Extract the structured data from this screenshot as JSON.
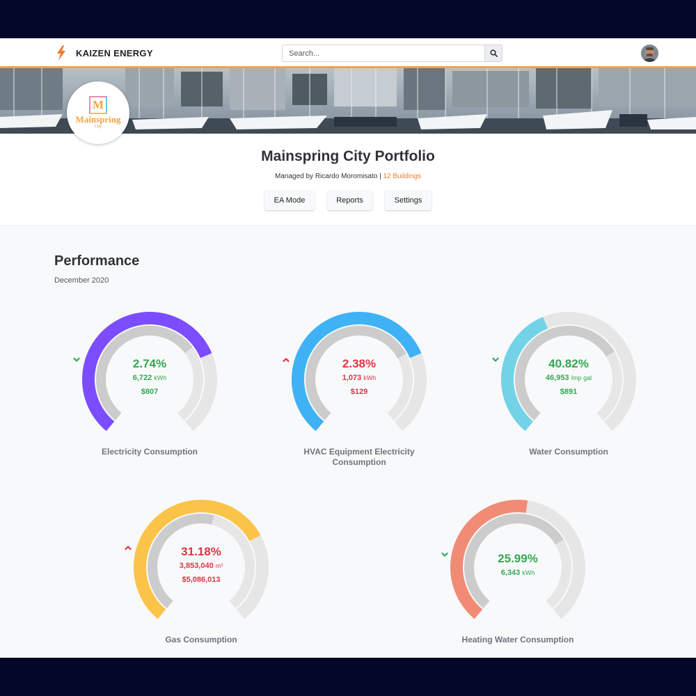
{
  "brand": {
    "name": "KAIZEN ENERGY",
    "icon": "lightning-bolt-icon",
    "color": "#f07a30"
  },
  "search": {
    "placeholder": "Search...",
    "icon": "search-icon"
  },
  "user": {
    "avatar": "user-avatar"
  },
  "portfolio": {
    "logo_text": "M",
    "logo_name": "Mainspring",
    "logo_sub": "City",
    "title": "Mainspring City Portfolio",
    "managed_by": "Managed by Ricardo Moromisato",
    "separator": "|",
    "buildings": "12 Buildings"
  },
  "actions": {
    "ea_mode": "EA Mode",
    "reports": "Reports",
    "settings": "Settings"
  },
  "performance": {
    "title": "Performance",
    "date": "December 2020"
  },
  "gauges": [
    {
      "label": "Electricity Consumption",
      "direction": "down",
      "percent": "2.74%",
      "usage": "6,722",
      "unit": "kWh",
      "cost": "$807",
      "color": "#7c4dff",
      "fill_fraction": 0.74,
      "inner_fraction": 0.69,
      "status": "green"
    },
    {
      "label": "HVAC Equipment Electricity Consumption",
      "direction": "up",
      "percent": "2.38%",
      "usage": "1,073",
      "unit": "kWh",
      "cost": "$129",
      "color": "#3eb2f5",
      "fill_fraction": 0.74,
      "inner_fraction": 0.72,
      "status": "red"
    },
    {
      "label": "Water Consumption",
      "direction": "down",
      "percent": "40.82%",
      "usage": "46,953",
      "unit": "Imp gal",
      "cost": "$891",
      "color": "#72d3e6",
      "fill_fraction": 0.42,
      "inner_fraction": 0.71,
      "status": "green"
    },
    {
      "label": "Gas Consumption",
      "direction": "up",
      "percent": "31.18%",
      "usage": "3,853,040",
      "unit": "m³",
      "cost": "$5,086,013",
      "color": "#fbc449",
      "fill_fraction": 0.72,
      "inner_fraction": 0.55,
      "status": "red"
    },
    {
      "label": "Heating Water Consumption",
      "direction": "down",
      "percent": "25.99%",
      "usage": "6,343",
      "unit": "kWh",
      "cost": "",
      "color": "#f28b76",
      "fill_fraction": 0.53,
      "inner_fraction": 0.71,
      "status": "green"
    }
  ],
  "colors": {
    "accent": "#f07a30",
    "up": "#dc3545",
    "down": "#32a852",
    "track": "#e6e6e6",
    "inner": "#cccccc"
  }
}
